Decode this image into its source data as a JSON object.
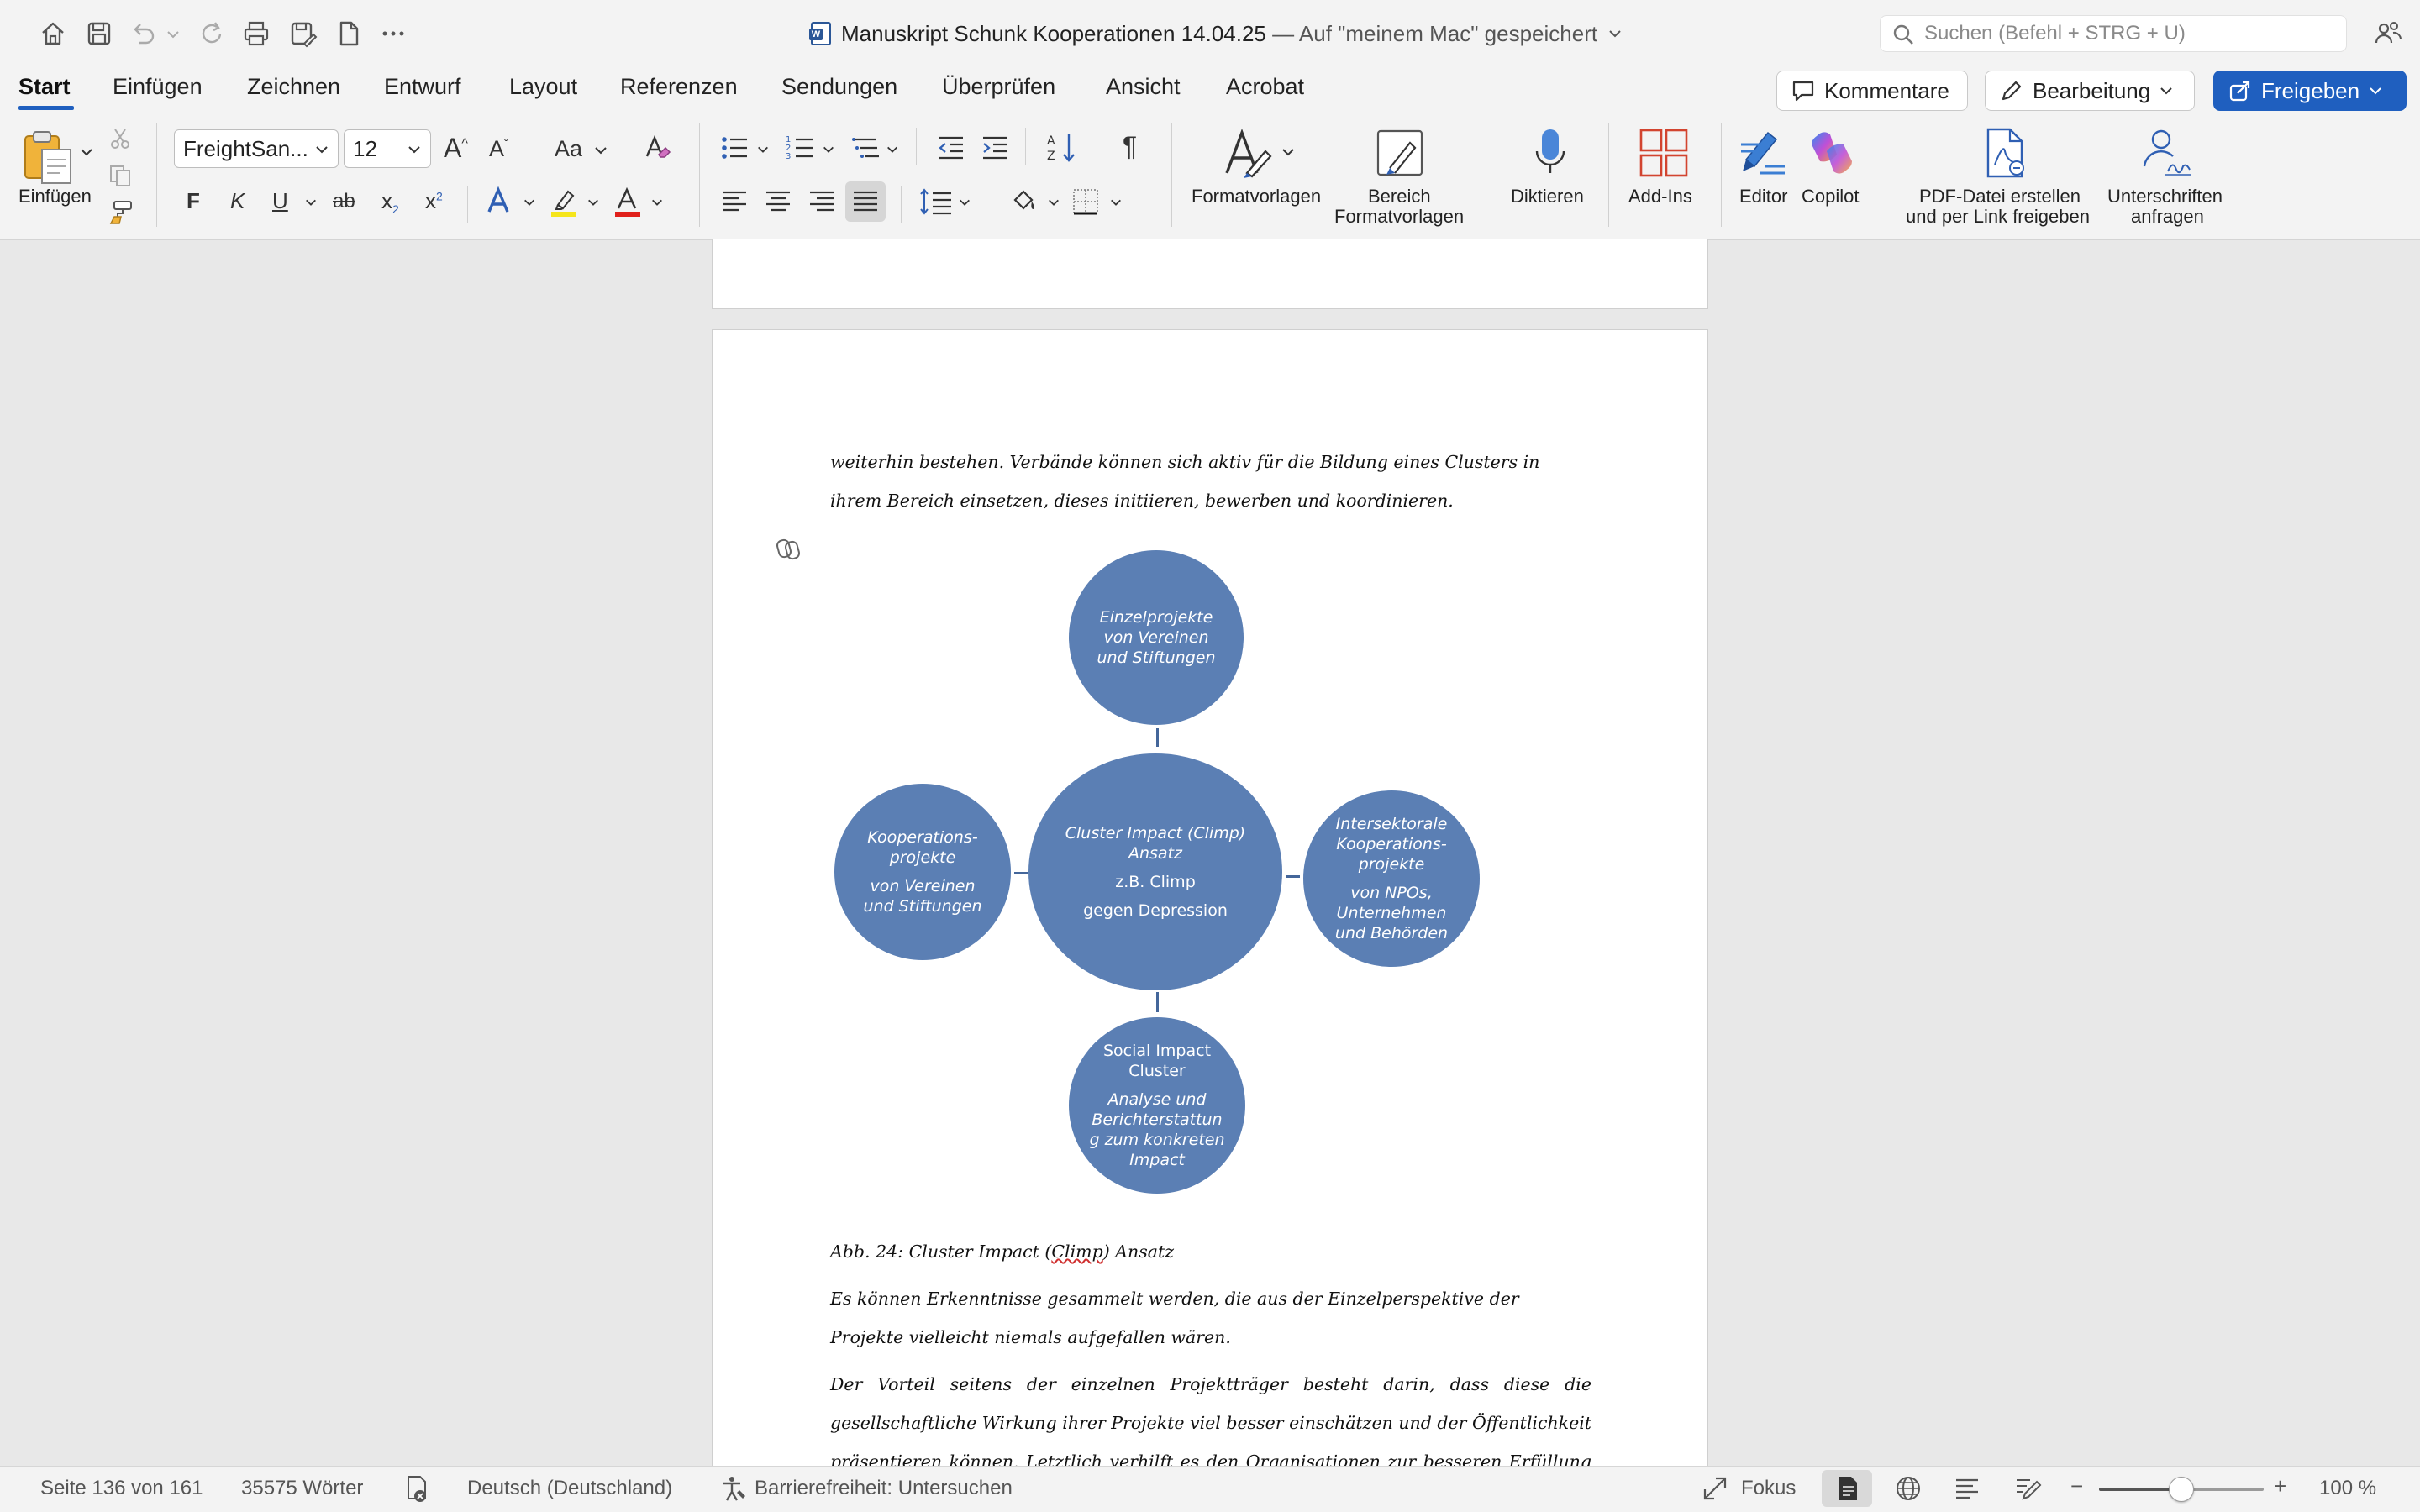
{
  "window": {
    "document_title": "Manuskript Schunk Kooperationen 14.04.25",
    "save_status": " — Auf \"meinem Mac\" gespeichert",
    "word_badge": "W",
    "search_placeholder": "Suchen (Befehl + STRG + U)"
  },
  "tabs": [
    "Start",
    "Einfügen",
    "Zeichnen",
    "Entwurf",
    "Layout",
    "Referenzen",
    "Sendungen",
    "Überprüfen",
    "Ansicht",
    "Acrobat"
  ],
  "active_tab": "Start",
  "header_buttons": {
    "comments": "Kommentare",
    "editing": "Bearbeitung",
    "share": "Freigeben"
  },
  "ribbon": {
    "paste_label": "Einfügen",
    "font_name": "FreightSan...",
    "font_size": "12",
    "bold": "F",
    "italic": "K",
    "underline": "U",
    "strikethrough": "ab",
    "subscript": "x",
    "subscript_mark": "2",
    "superscript": "x",
    "superscript_mark": "2",
    "grow_font": "A",
    "shrink_font": "A",
    "change_case": "Aa",
    "paragraph_mark": "¶",
    "styles_label": "Formatvorlagen",
    "styles_pane_label_1": "Bereich",
    "styles_pane_label_2": "Formatvorlagen",
    "dictate_label": "Diktieren",
    "addins_label": "Add-Ins",
    "editor_label": "Editor",
    "copilot_label": "Copilot",
    "pdf_label_1": "PDF-Datei erstellen",
    "pdf_label_2": "und per Link freigeben",
    "signature_label_1": "Unterschriften",
    "signature_label_2": "anfragen",
    "colors": {
      "highlight": "#f5e51b",
      "font_color": "#e0201b",
      "text_effect": "#2f5fb3",
      "accent": "#1f5fbf"
    }
  },
  "document": {
    "para_top": "weiterhin bestehen. Verbände können sich aktiv für die Bildung eines Clusters in ihrem Bereich einsetzen, dieses initiieren, bewerben und koordinieren.",
    "diagram": {
      "top": {
        "line1": "Einzelprojekte",
        "line2": "von Vereinen",
        "line3": "und Stiftungen"
      },
      "left": {
        "line1": "Kooperations-",
        "line2": "projekte",
        "line3": "von Vereinen",
        "line4": "und Stiftungen"
      },
      "center": {
        "line1": "Cluster Impact (Climp)",
        "line2": "Ansatz",
        "line3": "z.B. Climp",
        "line4": "gegen Depression"
      },
      "right": {
        "line1": "Intersektorale",
        "line2": "Kooperations-",
        "line3": "projekte",
        "line4": "von NPOs,",
        "line5": "Unternehmen",
        "line6": "und Behörden"
      },
      "bottom": {
        "line1": "Social Impact",
        "line2": "Cluster",
        "line3": "Analyse und",
        "line4": "Berichterstattun",
        "line5": "g zum konkreten",
        "line6": "Impact"
      },
      "fill_color": "#5b7fb4"
    },
    "caption_before": "Abb. 24: Cluster Impact (",
    "caption_underlined": "Climp",
    "caption_after": ") Ansatz",
    "para_2": "Es können Erkenntnisse gesammelt werden, die aus der Einzelperspektive der Projekte vielleicht niemals aufgefallen wären.",
    "para_3": "Der Vorteil seitens der einzelnen Projektträger besteht darin, dass diese die gesellschaftliche Wirkung ihrer Projekte viel besser einschätzen und der Öffentlichkeit präsentieren können. Letztlich verhilft es den Organisationen zur besseren Erfüllung der gesellschaftsfördernden"
  },
  "status_bar": {
    "page": "Seite 136 von 161",
    "words": "35575 Wörter",
    "language": "Deutsch (Deutschland)",
    "accessibility": "Barrierefreiheit: Untersuchen",
    "focus": "Fokus",
    "zoom_minus": "−",
    "zoom_plus": "+",
    "zoom": "100 %",
    "zoom_slider_fraction": 0.5
  }
}
